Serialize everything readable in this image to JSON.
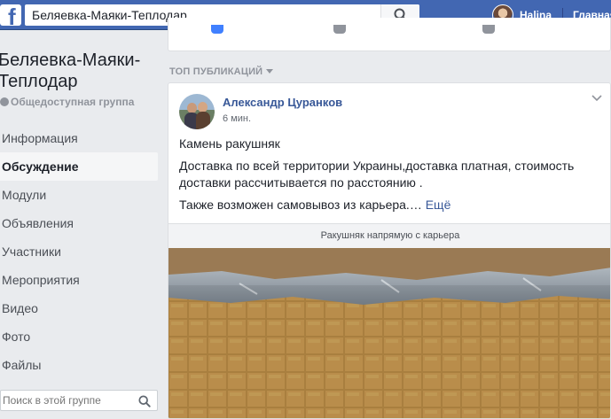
{
  "topbar": {
    "logo": "f",
    "search_value": "Беляевка-Маяки-Теплодар",
    "user_name": "Halina",
    "home_link": "Главная"
  },
  "group": {
    "title": "Беляевка-Маяки-Теплодар",
    "type": "Общедоступная группа",
    "nav": [
      {
        "label": "Информация",
        "active": false
      },
      {
        "label": "Обсуждение",
        "active": true
      },
      {
        "label": "Модули",
        "active": false
      },
      {
        "label": "Объявления",
        "active": false
      },
      {
        "label": "Участники",
        "active": false
      },
      {
        "label": "Мероприятия",
        "active": false
      },
      {
        "label": "Видео",
        "active": false
      },
      {
        "label": "Фото",
        "active": false
      },
      {
        "label": "Файлы",
        "active": false
      }
    ],
    "search_placeholder": "Поиск в этой группе"
  },
  "feed": {
    "section_label": "ТОП ПУБЛИКАЦИЙ",
    "post": {
      "author": "Александр Цуранков",
      "time": "6 мин.",
      "line1": "Камень ракушняк",
      "line2": "Доставка по всей территории Украины,доставка платная, стоимость доставки рассчитывается по расстоянию .",
      "line3": "Также возможен самовывоз из карьера.…",
      "more_label": "Ещё",
      "link_caption": "Ракушняк напрямую с карьера"
    }
  },
  "colors": {
    "brand": "#4267b2",
    "link": "#385898",
    "background": "#e9ebee"
  }
}
